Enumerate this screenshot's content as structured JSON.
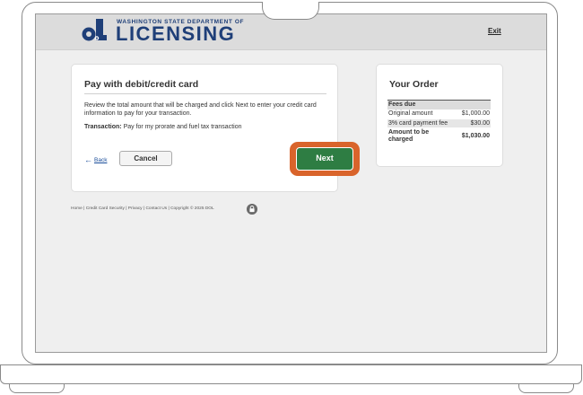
{
  "header": {
    "department_line": "WASHINGTON STATE DEPARTMENT OF",
    "agency_name": "LICENSING",
    "exit_label": "Exit"
  },
  "payment": {
    "title": "Pay with debit/credit card",
    "description": "Review the total amount that will be charged and click Next to enter your credit card information to pay for your transaction.",
    "transaction_label": "Transaction:",
    "transaction_value": "Pay for my prorate and fuel tax transaction",
    "back_label": "Back",
    "cancel_label": "Cancel",
    "next_label": "Next"
  },
  "order": {
    "title": "Your Order",
    "section_label": "Fees due",
    "rows": [
      {
        "label": "Original amount",
        "value": "$1,000.00"
      },
      {
        "label": "3% card payment fee",
        "value": "$30.00"
      },
      {
        "label": "Amount to be charged",
        "value": "$1,030.00"
      }
    ]
  },
  "footer": {
    "links_text": "Home | Credit Card Security | Privacy | Contact Us | Copyright © 2025 DOL"
  },
  "colors": {
    "brand_blue": "#1f3f78",
    "next_green": "#2e7d43",
    "highlight_orange": "#d9642b"
  },
  "icons": [
    "dol-logo-icon",
    "back-arrow-icon",
    "lock-icon"
  ]
}
